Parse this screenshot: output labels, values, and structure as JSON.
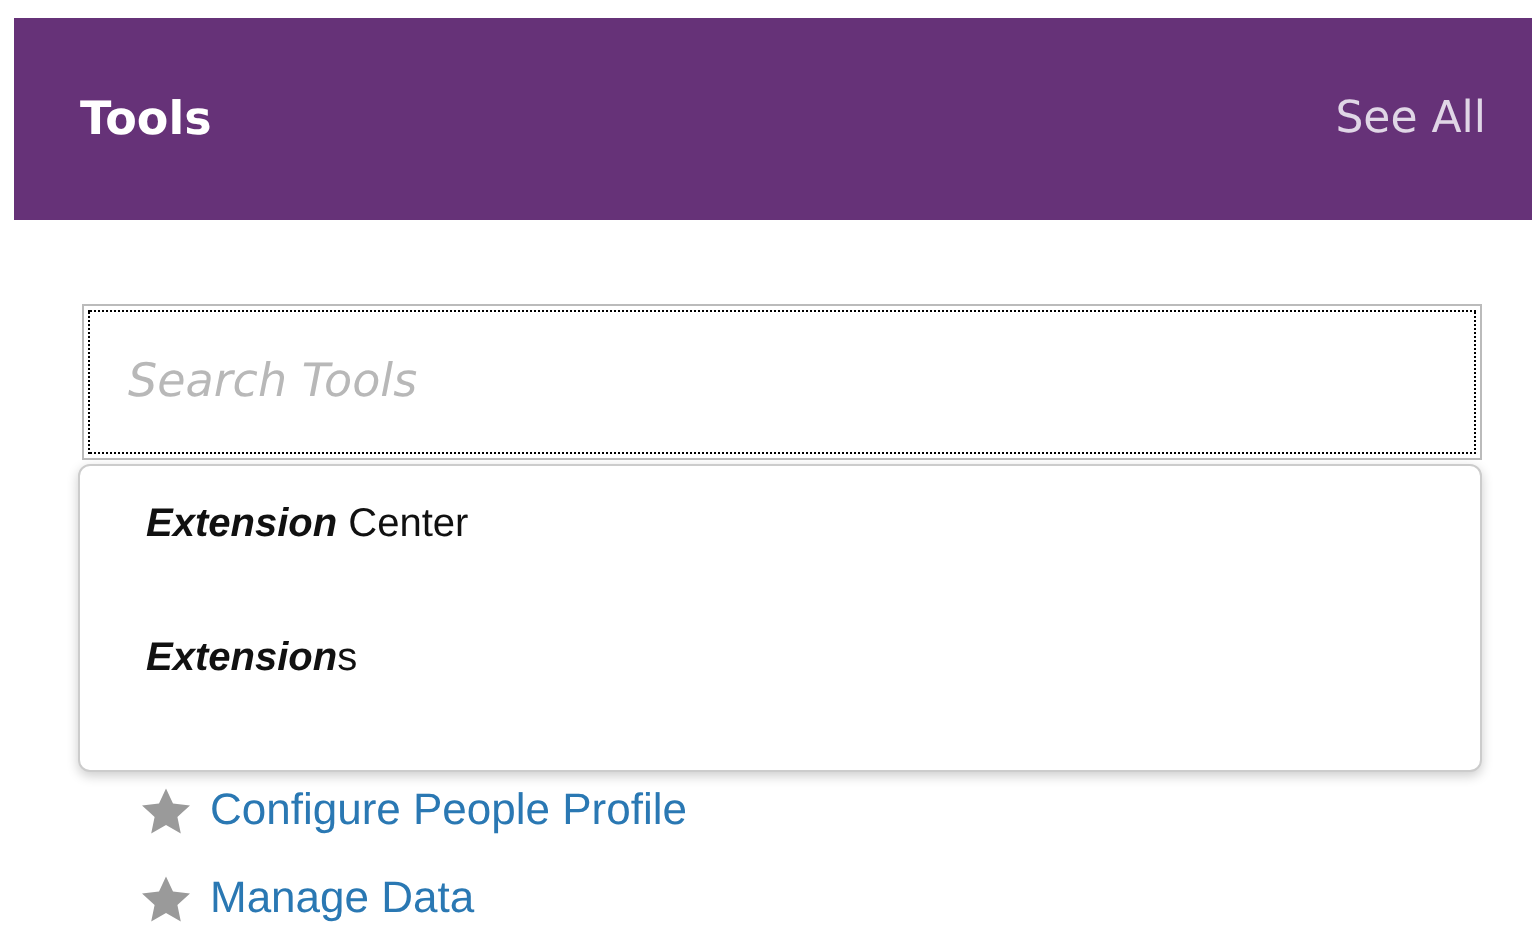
{
  "header": {
    "title": "Tools",
    "link": "See All"
  },
  "search": {
    "placeholder": "Search Tools"
  },
  "suggestions": [
    {
      "match": "Extension",
      "rest": " Center"
    },
    {
      "match": "Extension",
      "rest": "s"
    }
  ],
  "tools": [
    {
      "label": "Configure People Profile"
    },
    {
      "label": "Manage Data"
    }
  ]
}
